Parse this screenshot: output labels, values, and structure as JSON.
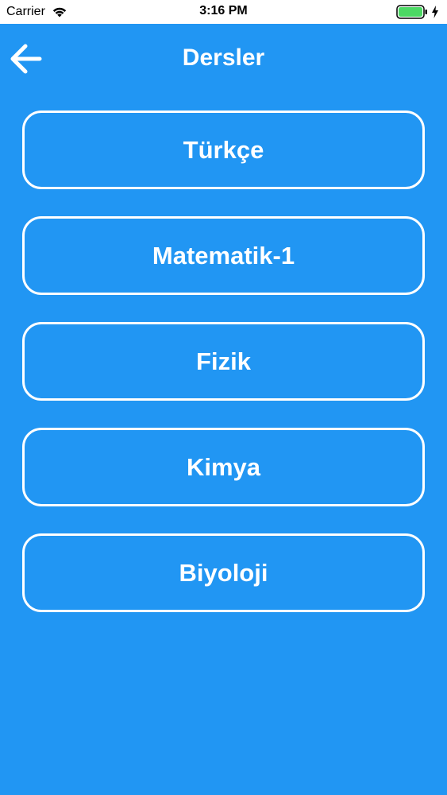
{
  "status_bar": {
    "carrier": "Carrier",
    "time": "3:16 PM",
    "icons": [
      "wifi-icon",
      "battery-icon",
      "charging-icon"
    ],
    "battery_color": "#4cd964"
  },
  "nav": {
    "title": "Dersler",
    "back_icon": "arrow-left-icon"
  },
  "subjects": [
    {
      "label": "Türkçe"
    },
    {
      "label": "Matematik-1"
    },
    {
      "label": "Fizik"
    },
    {
      "label": "Kimya"
    },
    {
      "label": "Biyoloji"
    }
  ],
  "colors": {
    "background": "#2196f3",
    "foreground": "#ffffff",
    "status_bar_bg": "#ffffff"
  }
}
